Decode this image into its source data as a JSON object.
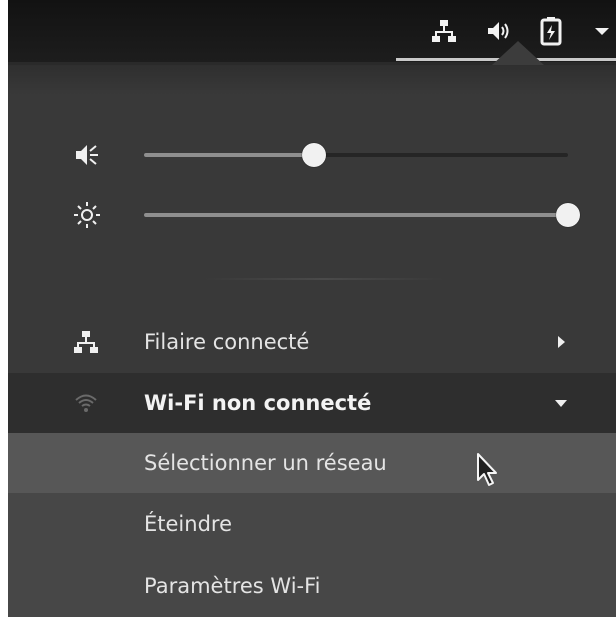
{
  "topbar": {
    "icons": [
      "network-wired-icon",
      "volume-icon",
      "battery-charging-icon",
      "dropdown-arrow-icon"
    ]
  },
  "sliders": {
    "volume": {
      "icon": "speaker-muted-icon",
      "value_percent": 40
    },
    "brightness": {
      "icon": "brightness-icon",
      "value_percent": 100
    }
  },
  "menu": {
    "wired": {
      "icon": "network-wired-icon",
      "label": "Filaire connecté"
    },
    "wifi": {
      "icon": "wifi-icon",
      "label": "Wi-Fi non connecté"
    },
    "wifi_submenu": [
      {
        "label": "Sélectionner un réseau"
      },
      {
        "label": "Éteindre"
      },
      {
        "label": "Paramètres Wi-Fi"
      }
    ]
  },
  "colors": {
    "topbar": "#161616",
    "menu_bg": "#393939",
    "submenu_bg": "#474747",
    "hover_bg": "#575757",
    "text": "#e4e4e4"
  }
}
